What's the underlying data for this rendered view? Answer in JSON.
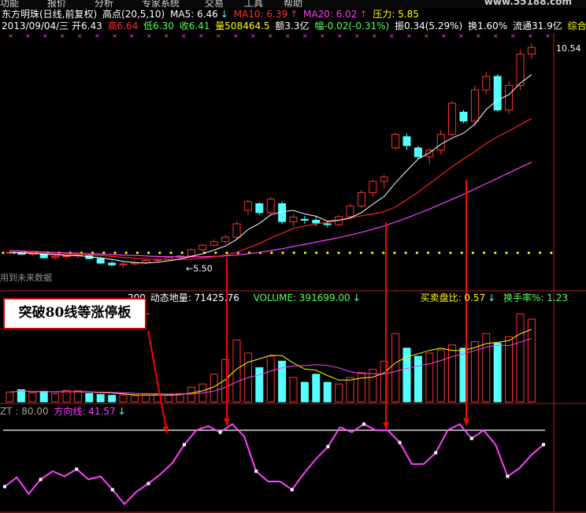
{
  "menu": {
    "items": [
      "功能",
      "报价",
      "分析",
      "专家系统",
      "交易",
      "工具",
      "帮助"
    ],
    "watermark": "www.55188.com"
  },
  "header": {
    "line1": {
      "name": "东方明珠(日线,前复权)",
      "peak": "高点(20,5,10)",
      "ma5": "MA5: 6.46",
      "ma10": "MA10: 6.39",
      "ma20": "MA20: 6.02",
      "pressure": "压力: 5.85"
    },
    "line2": {
      "date": "2013/09/04/三",
      "open": "开6.43",
      "high": "高6.64",
      "low": "低6.30",
      "close": "收6.41",
      "volume": "量508464.5",
      "amount": "额3.3亿",
      "change": "幅-0.02(-0.31%)",
      "amplitude": "振0.34(5.29%)",
      "turnover": "换1.60%",
      "float": "流通31.9亿",
      "industry": "综合行业"
    }
  },
  "panel2": {
    "l0": "200",
    "l1": "动态地量: 71425.76",
    "l2": "VOLUME: 391699.00",
    "l3": "买卖盘比: 0.57",
    "l4": "换手率%: 1.23"
  },
  "panel3": {
    "zt": "ZT : 80.00",
    "direction": "方向线: 41.57"
  },
  "annotation": {
    "callout": "突破80线等涨停板"
  },
  "main_labels": {
    "max_price": "10.54",
    "min_price": "5.50",
    "future_text": "用到未来数据"
  },
  "colors": {
    "up": "#ff3232",
    "down": "#54ffff",
    "ma5": "#ffffff",
    "ma10": "#ff2020",
    "ma20": "#ff40ff",
    "dots": "#ffff00",
    "direction": "#ff40ff",
    "zt": "#a0a0a0"
  },
  "chart_data": [
    {
      "type": "candlestick",
      "title": "东方明珠(日线,前复权)",
      "max_label": 10.54,
      "min_label": 5.5,
      "pressure": 5.85,
      "candles": [
        [
          5.85,
          5.9,
          5.82,
          5.86
        ],
        [
          5.86,
          5.88,
          5.8,
          5.82
        ],
        [
          5.82,
          5.86,
          5.78,
          5.84
        ],
        [
          5.84,
          5.86,
          5.72,
          5.74
        ],
        [
          5.74,
          5.8,
          5.7,
          5.77
        ],
        [
          5.77,
          5.8,
          5.72,
          5.78
        ],
        [
          5.78,
          5.82,
          5.74,
          5.8
        ],
        [
          5.8,
          5.82,
          5.7,
          5.72
        ],
        [
          5.72,
          5.75,
          5.6,
          5.62
        ],
        [
          5.62,
          5.66,
          5.55,
          5.58
        ],
        [
          5.58,
          5.64,
          5.52,
          5.6
        ],
        [
          5.6,
          5.68,
          5.56,
          5.63
        ],
        [
          5.63,
          5.72,
          5.6,
          5.68
        ],
        [
          5.68,
          5.74,
          5.62,
          5.7
        ],
        [
          5.7,
          5.78,
          5.66,
          5.75
        ],
        [
          5.75,
          5.8,
          5.7,
          5.78
        ],
        [
          5.78,
          5.95,
          5.75,
          5.92
        ],
        [
          5.92,
          6.05,
          5.88,
          6.02
        ],
        [
          6.02,
          6.15,
          5.98,
          6.1
        ],
        [
          6.1,
          6.25,
          6.05,
          6.2
        ],
        [
          6.2,
          6.55,
          6.15,
          6.5
        ],
        [
          6.8,
          7.05,
          6.7,
          7.0
        ],
        [
          6.95,
          6.98,
          6.7,
          6.75
        ],
        [
          6.75,
          7.1,
          6.7,
          7.05
        ],
        [
          6.95,
          7.0,
          6.5,
          6.55
        ],
        [
          6.55,
          6.72,
          6.45,
          6.65
        ],
        [
          6.6,
          6.68,
          6.5,
          6.58
        ],
        [
          6.58,
          6.65,
          6.45,
          6.52
        ],
        [
          6.5,
          6.55,
          6.42,
          6.48
        ],
        [
          6.48,
          6.7,
          6.45,
          6.66
        ],
        [
          6.66,
          6.95,
          6.6,
          6.9
        ],
        [
          6.9,
          7.25,
          6.85,
          7.2
        ],
        [
          7.2,
          7.5,
          7.1,
          7.45
        ],
        [
          7.45,
          7.6,
          7.3,
          7.55
        ],
        [
          8.2,
          8.55,
          8.15,
          8.5
        ],
        [
          8.45,
          8.52,
          8.15,
          8.25
        ],
        [
          8.2,
          8.25,
          7.95,
          8.0
        ],
        [
          8.0,
          8.2,
          7.85,
          8.15
        ],
        [
          8.15,
          8.6,
          8.05,
          8.5
        ],
        [
          8.5,
          9.25,
          8.45,
          9.2
        ],
        [
          9.0,
          9.05,
          8.75,
          8.8
        ],
        [
          8.8,
          9.6,
          8.7,
          9.5
        ],
        [
          9.5,
          9.9,
          9.4,
          9.8
        ],
        [
          9.8,
          9.85,
          9.0,
          9.05
        ],
        [
          9.05,
          9.7,
          8.95,
          9.6
        ],
        [
          9.6,
          10.4,
          9.5,
          10.3
        ],
        [
          10.3,
          10.54,
          10.2,
          10.45
        ]
      ],
      "ma5": [
        5.86,
        5.85,
        5.84,
        5.82,
        5.81,
        5.79,
        5.79,
        5.76,
        5.74,
        5.7,
        5.66,
        5.63,
        5.62,
        5.64,
        5.67,
        5.71,
        5.77,
        5.83,
        5.91,
        6.0,
        6.15,
        6.37,
        6.51,
        6.7,
        6.77,
        6.8,
        6.72,
        6.67,
        6.56,
        6.58,
        6.63,
        6.75,
        6.94,
        7.11,
        7.42,
        7.69,
        7.95,
        8.09,
        8.28,
        8.42,
        8.53,
        8.73,
        9.06,
        9.27,
        9.39,
        9.65,
        9.84
      ],
      "ma10": [
        5.86,
        5.86,
        5.85,
        5.84,
        5.83,
        5.82,
        5.81,
        5.8,
        5.79,
        5.77,
        5.75,
        5.73,
        5.71,
        5.7,
        5.7,
        5.7,
        5.71,
        5.73,
        5.76,
        5.8,
        5.86,
        5.96,
        6.06,
        6.18,
        6.29,
        6.4,
        6.45,
        6.5,
        6.53,
        6.58,
        6.63,
        6.68,
        6.72,
        6.77,
        6.88,
        7.04,
        7.21,
        7.4,
        7.59,
        7.78,
        7.95,
        8.12,
        8.3,
        8.45,
        8.58,
        8.72,
        8.86
      ],
      "ma20": [
        5.9,
        5.89,
        5.88,
        5.87,
        5.86,
        5.85,
        5.84,
        5.83,
        5.82,
        5.81,
        5.8,
        5.79,
        5.78,
        5.77,
        5.76,
        5.76,
        5.76,
        5.76,
        5.77,
        5.78,
        5.8,
        5.83,
        5.86,
        5.9,
        5.94,
        5.99,
        6.04,
        6.09,
        6.14,
        6.19,
        6.25,
        6.31,
        6.38,
        6.45,
        6.54,
        6.63,
        6.73,
        6.83,
        6.94,
        7.05,
        7.16,
        7.28,
        7.4,
        7.52,
        7.64,
        7.76,
        7.88
      ]
    },
    {
      "type": "bar",
      "title": "VOLUME",
      "ylim": [
        0,
        600000
      ],
      "values": [
        60000,
        75000,
        55000,
        65000,
        50000,
        70000,
        68000,
        52000,
        45000,
        40000,
        42000,
        38000,
        44000,
        47000,
        40000,
        52000,
        90000,
        110000,
        170000,
        260000,
        380000,
        300000,
        210000,
        280000,
        250000,
        150000,
        120000,
        170000,
        120000,
        110000,
        150000,
        180000,
        200000,
        250000,
        420000,
        330000,
        280000,
        300000,
        320000,
        350000,
        330000,
        370000,
        420000,
        360000,
        400000,
        540000,
        508000
      ],
      "up": [
        1,
        0,
        1,
        0,
        1,
        1,
        1,
        0,
        0,
        0,
        1,
        1,
        1,
        1,
        1,
        1,
        1,
        1,
        1,
        1,
        1,
        1,
        0,
        1,
        0,
        1,
        0,
        0,
        0,
        1,
        1,
        1,
        1,
        1,
        1,
        0,
        0,
        1,
        1,
        1,
        0,
        1,
        1,
        0,
        1,
        1,
        1
      ]
    },
    {
      "type": "line",
      "title": "方向线",
      "zt": 80,
      "ylim": [
        0,
        100
      ],
      "values": [
        25,
        34,
        18,
        32,
        40,
        35,
        42,
        32,
        35,
        22,
        8,
        20,
        28,
        37,
        48,
        66,
        80,
        84,
        78,
        86,
        74,
        40,
        30,
        30,
        22,
        38,
        52,
        64,
        83,
        78,
        86,
        80,
        80,
        68,
        47,
        47,
        58,
        80,
        86,
        72,
        80,
        66,
        35,
        43,
        56,
        66
      ]
    }
  ]
}
